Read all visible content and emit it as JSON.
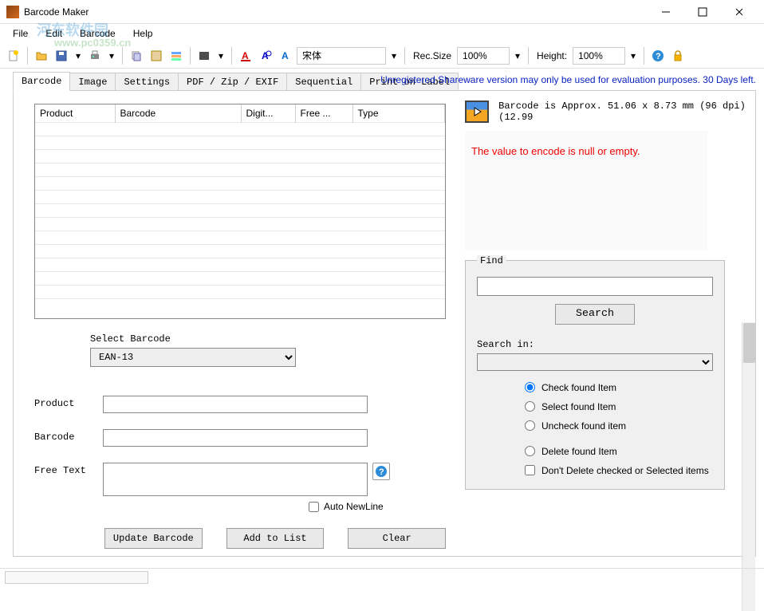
{
  "window": {
    "title": "Barcode Maker"
  },
  "menu": {
    "file": "File",
    "edit": "Edit",
    "barcode": "Barcode",
    "help": "Help"
  },
  "toolbar": {
    "font_name": "宋体",
    "rec_size_label": "Rec.Size",
    "rec_size_value": "100%",
    "height_label": "Height:",
    "height_value": "100%"
  },
  "shareware": "Unregistered Shareware version may only be used for evaluation purposes. 30 Days left.",
  "tabs": {
    "barcode": "Barcode",
    "image": "Image",
    "settings": "Settings",
    "pdf": "PDF / Zip / EXIF",
    "sequential": "Sequential",
    "print": "Print on Label"
  },
  "table": {
    "headers": {
      "product": "Product",
      "barcode": "Barcode",
      "digit": "Digit...",
      "free": "Free ...",
      "type": "Type"
    }
  },
  "select_barcode": {
    "label": "Select Barcode",
    "value": "EAN-13"
  },
  "form": {
    "product_label": "Product",
    "barcode_label": "Barcode",
    "freetext_label": "Free Text",
    "auto_newline": "Auto NewLine"
  },
  "buttons": {
    "update": "Update Barcode",
    "add": "Add to List",
    "clear": "Clear",
    "search": "Search"
  },
  "info": {
    "approx": "Barcode is Approx. 51.06 x 8.73 mm  (96 dpi) (12.99",
    "error": "The value to encode is null or empty."
  },
  "find": {
    "legend": "Find",
    "search_in": "Search in:",
    "check_found": "Check found Item",
    "select_found": "Select found Item",
    "uncheck_found": "Uncheck found item",
    "delete_found": "Delete found Item",
    "dont_delete": "Don't Delete checked or Selected items"
  },
  "watermark": {
    "line1": "河东软件园",
    "line2": "www.pc0359.cn"
  }
}
